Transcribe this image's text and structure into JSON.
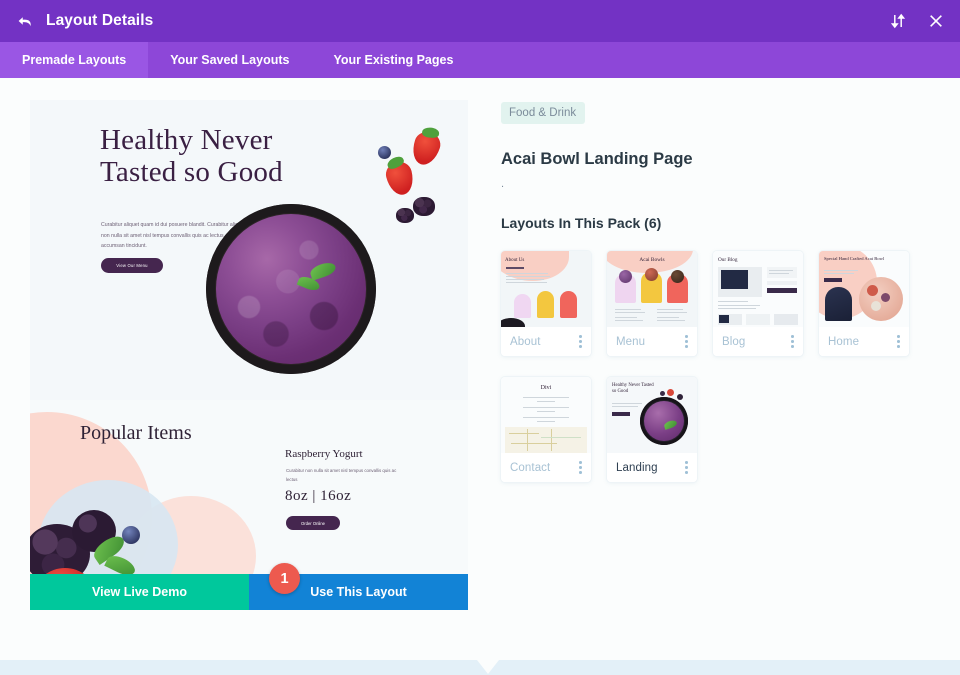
{
  "header": {
    "title": "Layout Details",
    "back_icon": "back-arrow-icon",
    "sort_icon": "sort-updown-icon",
    "close_icon": "close-icon"
  },
  "tabs": [
    {
      "label": "Premade Layouts",
      "active": true
    },
    {
      "label": "Your Saved Layouts",
      "active": false
    },
    {
      "label": "Your Existing Pages",
      "active": false
    }
  ],
  "preview": {
    "hero_title": "Healthy Never Tasted so Good",
    "hero_copy": "Curabitur aliquet quam id dui posuere blandit. Curabitur aliquet quam non nulla sit amet nisl tempus convallis quis ac lectus. Nulla porttitor accumsan tincidunt.",
    "hero_button": "View Our Menu",
    "popular_title": "Popular Items",
    "item_name": "Raspberry Yogurt",
    "item_copy": "Curabitur non nulla sit amet nisl tempus convallis quis ac lectus",
    "item_size": "8oz | 16oz",
    "item_button": "Order Online",
    "demo_button": "View Live Demo",
    "use_button": "Use This Layout",
    "step_badge": "1"
  },
  "details": {
    "category": "Food & Drink",
    "title": "Acai Bowl Landing Page",
    "description": ".",
    "pack_heading": "Layouts In This Pack (6)",
    "cards": [
      {
        "label": "About",
        "thumb_title": "About Us",
        "active": false,
        "menu_icon": "more-vertical-icon"
      },
      {
        "label": "Menu",
        "thumb_title": "Acai Bowls",
        "active": false,
        "menu_icon": "more-vertical-icon"
      },
      {
        "label": "Blog",
        "thumb_title": "Our Blog",
        "active": false,
        "menu_icon": "more-vertical-icon"
      },
      {
        "label": "Home",
        "thumb_title": "Special Hand Crafted Acai Bowl",
        "active": false,
        "menu_icon": "more-vertical-icon"
      },
      {
        "label": "Contact",
        "thumb_title": "Divi",
        "active": false,
        "menu_icon": "more-vertical-icon"
      },
      {
        "label": "Landing",
        "thumb_title": "Healthy Never Tasted so Good",
        "active": true,
        "menu_icon": "more-vertical-icon"
      }
    ]
  },
  "colors": {
    "header_purple": "#7332c4",
    "tabbar_purple": "#8d47d8",
    "tab_active_purple": "#9a56e4",
    "demo_green": "#00c89c",
    "use_blue": "#1283d6",
    "badge_red": "#ed5a4f",
    "category_badge_bg": "#e2f3ef",
    "bottom_strip": "#e3f0f8"
  }
}
